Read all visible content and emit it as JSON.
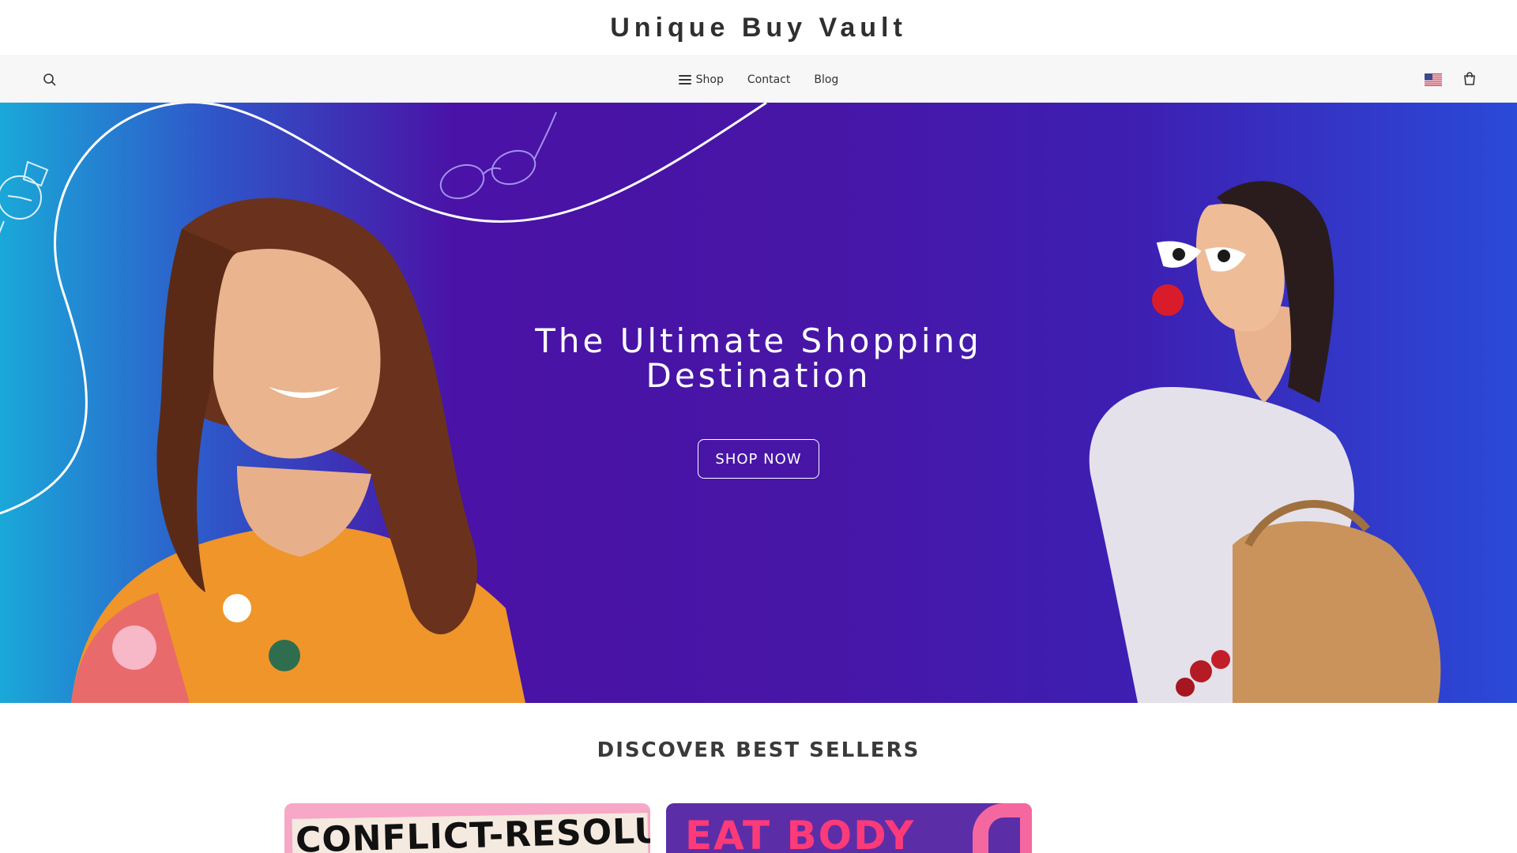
{
  "brand": {
    "title": "Unique Buy Vault"
  },
  "nav": {
    "search_icon": "search-icon",
    "links": [
      {
        "label": "Shop",
        "icon": "hamburger-menu-icon"
      },
      {
        "label": "Contact"
      },
      {
        "label": "Blog"
      }
    ],
    "locale_icon": "us-flag-icon",
    "cart_icon": "shopping-bag-icon"
  },
  "hero": {
    "title_line1": "The Ultimate Shopping",
    "title_line2": "Destination",
    "cta_label": "SHOP NOW",
    "colors": {
      "start": "#1aa8d8",
      "mid": "#4a12a6",
      "end": "#2a4ad8"
    }
  },
  "best_sellers": {
    "title": "DISCOVER BEST SELLERS",
    "cards": [
      {
        "visible_text": "CONFLICT-RESOLUTION"
      },
      {
        "visible_text": "EAT BODY"
      }
    ]
  }
}
